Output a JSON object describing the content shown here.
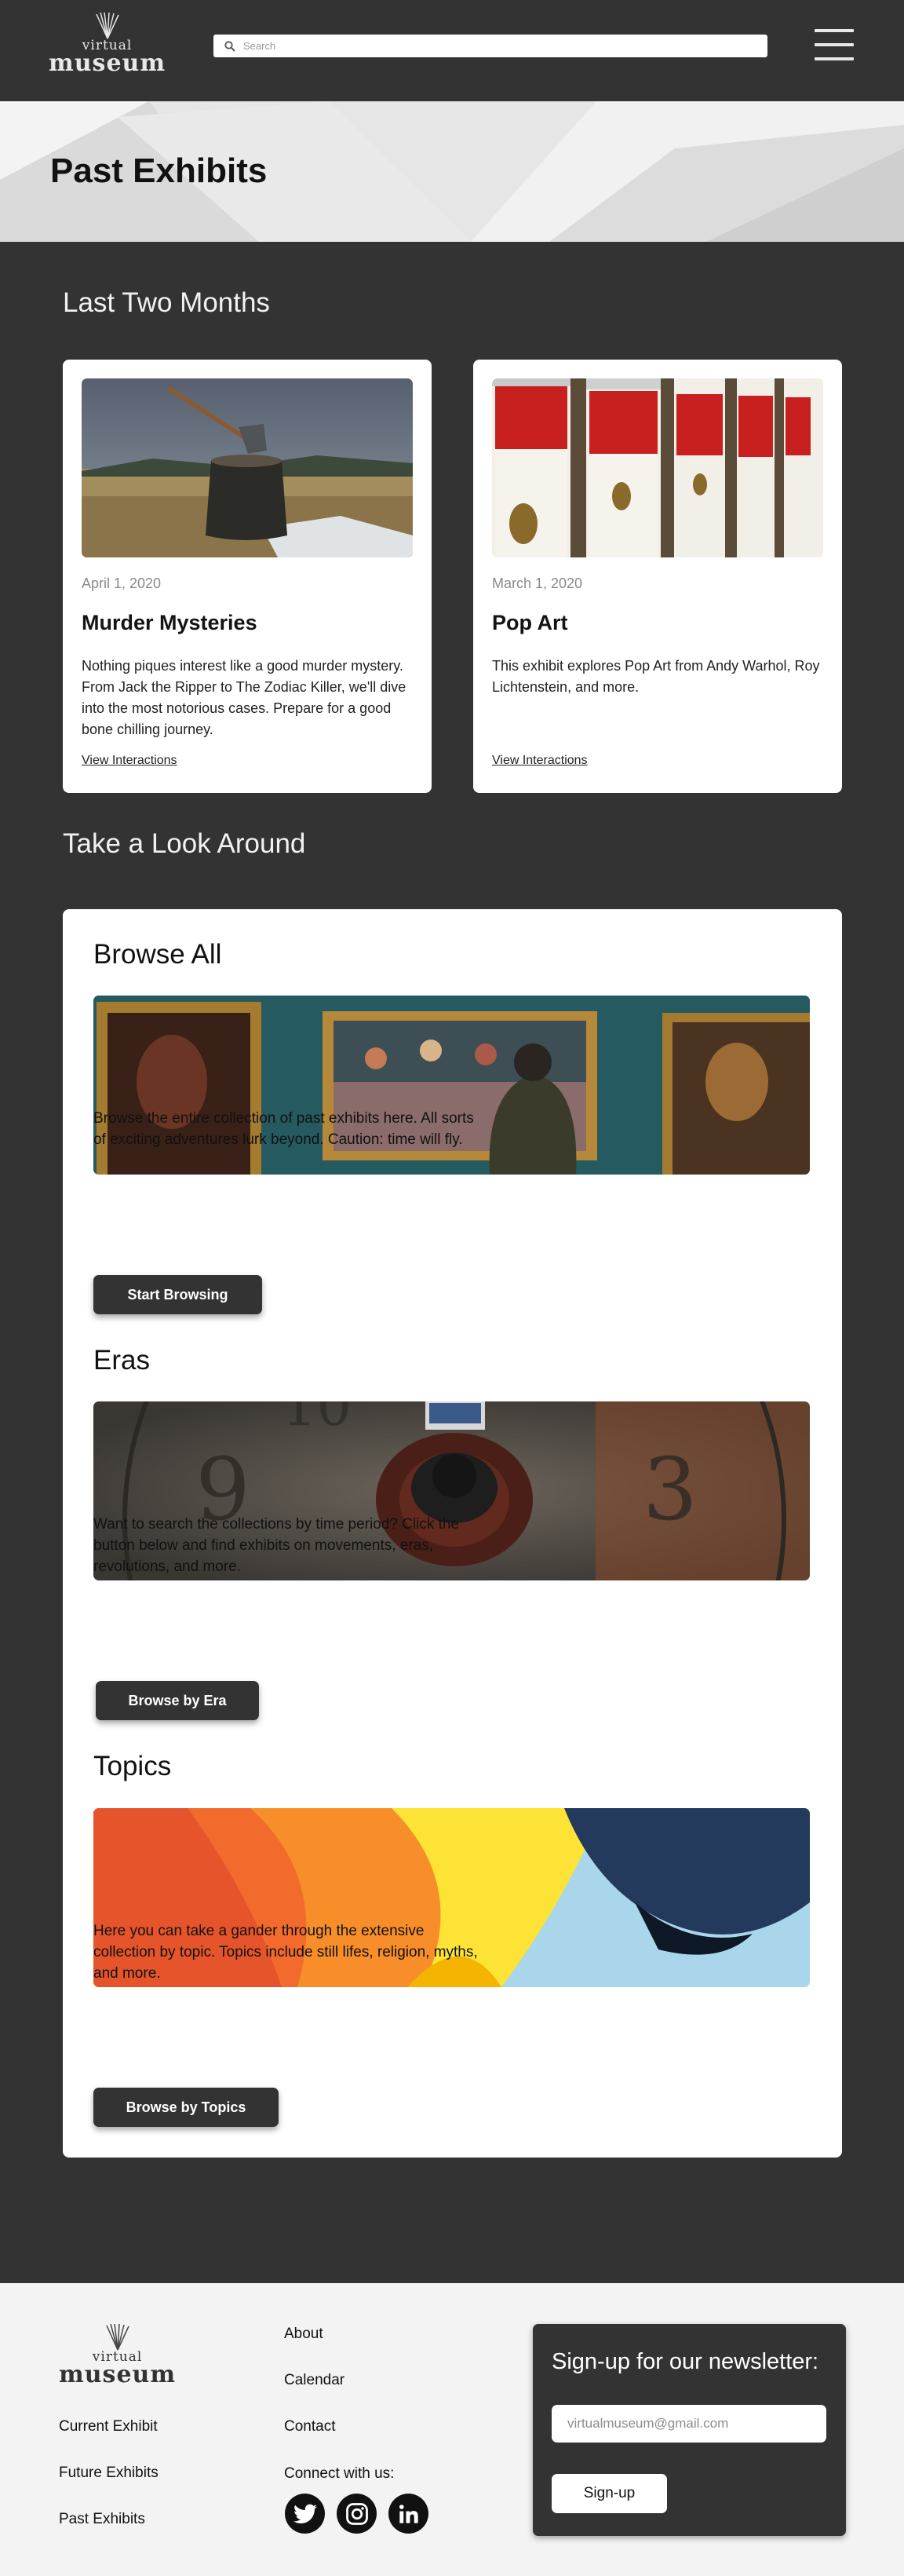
{
  "header": {
    "logo_small": "virtual",
    "logo_big": "museum",
    "search_placeholder": "Search",
    "menu_icon": "hamburger-menu-icon"
  },
  "hero": {
    "title": "Past Exhibits"
  },
  "recent": {
    "heading": "Last Two Months",
    "cards": [
      {
        "date": "April 1, 2020",
        "title": "Murder Mysteries",
        "description": "Nothing piques interest like a good murder mystery. From Jack the Ripper to The Zodiac Killer, we'll dive into the most notorious cases. Prepare for a good bone chilling journey.",
        "link": "View Interactions"
      },
      {
        "date": "March 1, 2020",
        "title": "Pop Art",
        "description": "This exhibit explores Pop Art from Andy Warhol, Roy Lichtenstein, and more.",
        "link": "View Interactions"
      }
    ]
  },
  "look_around": {
    "heading": "Take a Look Around",
    "blocks": [
      {
        "title": "Browse All",
        "description": "Browse the entire collection of past exhibits here. All sorts of exciting adventures lurk beyond. Caution: time will fly.",
        "button": "Start Browsing"
      },
      {
        "title": "Eras",
        "description": "Want to search the collections by time period? Click the button below and find exhibits on movements, eras, revolutions, and more.",
        "button": "Browse by Era"
      },
      {
        "title": "Topics",
        "description": "Here you can take a gander through the extensive collection by topic. Topics include still lifes, religion, myths, and more.",
        "button": "Browse by Topics"
      }
    ]
  },
  "footer": {
    "logo_small": "virtual",
    "logo_big": "museum",
    "links_left": [
      "Current Exhibit",
      "Future Exhibits",
      "Past Exhibits"
    ],
    "links_mid": [
      "About",
      "Calendar",
      "Contact"
    ],
    "connect_label": "Connect with us:",
    "social_icons": [
      "twitter-icon",
      "instagram-icon",
      "linkedin-icon"
    ],
    "newsletter": {
      "heading": "Sign-up for our newsletter:",
      "email_placeholder": "virtualmuseum@gmail.com",
      "button": "Sign-up"
    }
  },
  "colors": {
    "page_background": "#333333",
    "card_background": "#ffffff",
    "footer_background": "#f3f3f3",
    "button_background": "#333333"
  }
}
